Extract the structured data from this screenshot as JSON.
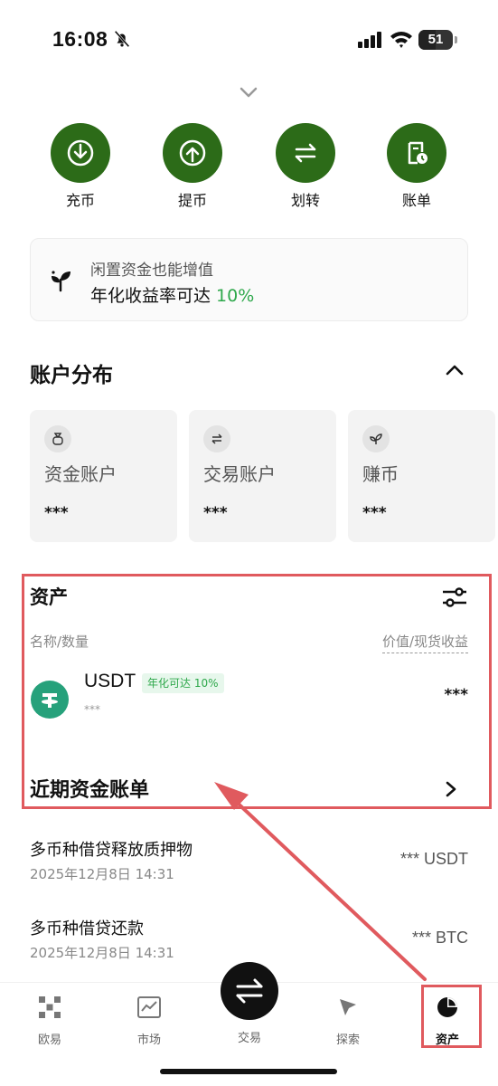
{
  "status_bar": {
    "time": "16:08",
    "battery": "51",
    "battery_level": 0.51,
    "icons": [
      "bell-off-icon",
      "signal-icon",
      "wifi-icon",
      "battery-icon"
    ]
  },
  "quick_actions": [
    {
      "label": "充币",
      "icon": "deposit-icon"
    },
    {
      "label": "提币",
      "icon": "withdraw-icon"
    },
    {
      "label": "划转",
      "icon": "transfer-icon"
    },
    {
      "label": "账单",
      "icon": "bill-icon"
    }
  ],
  "promo": {
    "subtitle": "闲置资金也能增值",
    "main_prefix": "年化收益率可达 ",
    "main_highlight": "10%",
    "icon": "sprout-icon"
  },
  "account_distribution": {
    "title": "账户分布",
    "cards": [
      {
        "name": "资金账户",
        "value": "***",
        "icon": "money-bag-icon"
      },
      {
        "name": "交易账户",
        "value": "***",
        "icon": "swap-icon"
      },
      {
        "name": "赚币",
        "value": "***",
        "icon": "sprout-icon"
      }
    ]
  },
  "assets": {
    "title": "资产",
    "col_left": "名称/数量",
    "col_right": "价值/现货收益",
    "items": [
      {
        "symbol": "USDT",
        "badge": "年化可达 10%",
        "amount": "***",
        "value": "***",
        "icon": "tether-icon"
      }
    ]
  },
  "bills": {
    "title": "近期资金账单",
    "items": [
      {
        "title": "多币种借贷释放质押物",
        "date": "2025年12月8日 14:31",
        "amount": "*** USDT"
      },
      {
        "title": "多币种借贷还款",
        "date": "2025年12月8日 14:31",
        "amount": "*** BTC"
      }
    ]
  },
  "tabbar": {
    "items": [
      {
        "label": "欧易",
        "icon": "okx-logo-icon"
      },
      {
        "label": "市场",
        "icon": "market-chart-icon"
      },
      {
        "label": "交易",
        "icon": "trade-swap-icon"
      },
      {
        "label": "探索",
        "icon": "compass-icon"
      },
      {
        "label": "资产",
        "icon": "pie-chart-icon",
        "active": true
      }
    ]
  },
  "colors": {
    "accent_green": "#2c6b18",
    "positive": "#2ea84b",
    "annotation_red": "#e05a5e"
  }
}
